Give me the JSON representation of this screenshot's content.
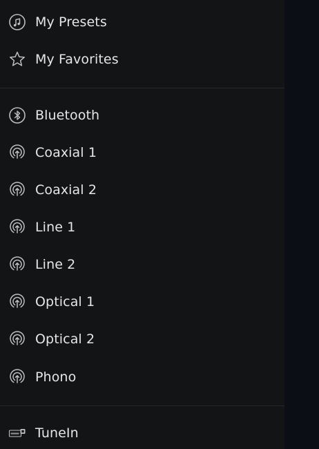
{
  "menu": {
    "top_items": [
      {
        "label": "My Presets",
        "icon": "music-note-icon"
      },
      {
        "label": "My Favorites",
        "icon": "star-icon"
      }
    ],
    "source_items": [
      {
        "label": "Bluetooth",
        "icon": "bluetooth-icon"
      },
      {
        "label": "Coaxial 1",
        "icon": "input-source-icon"
      },
      {
        "label": "Coaxial 2",
        "icon": "input-source-icon"
      },
      {
        "label": "Line 1",
        "icon": "input-source-icon"
      },
      {
        "label": "Line 2",
        "icon": "input-source-icon"
      },
      {
        "label": "Optical 1",
        "icon": "input-source-icon"
      },
      {
        "label": "Optical 2",
        "icon": "input-source-icon"
      },
      {
        "label": "Phono",
        "icon": "input-source-icon"
      }
    ],
    "service_items": [
      {
        "label": "TuneIn",
        "icon": "tunein-icon"
      }
    ]
  },
  "colors": {
    "drawer_background": "#131416",
    "overlay_background": "#0b0e14",
    "text": "#e6e6e6",
    "icon": "#bfbfbf",
    "divider": "#26282b"
  }
}
